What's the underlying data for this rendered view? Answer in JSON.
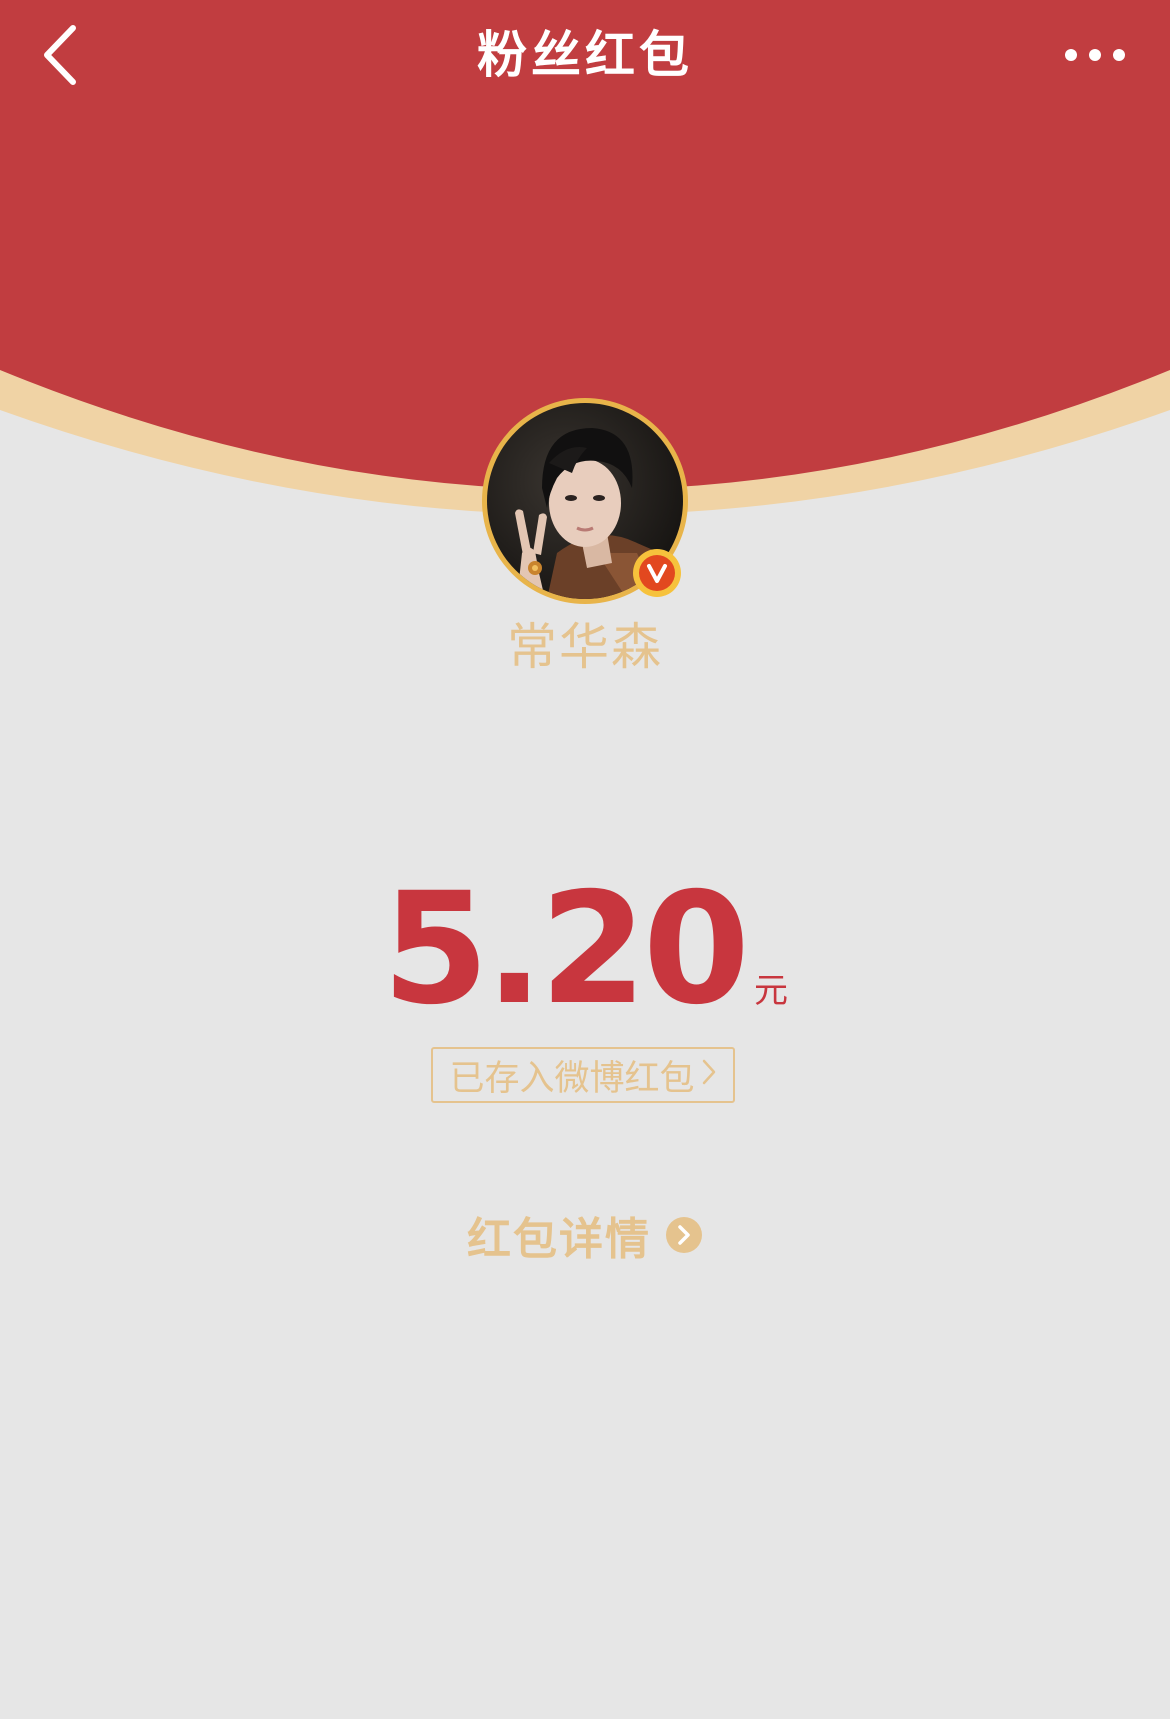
{
  "nav": {
    "title": "粉丝红包",
    "back_icon": "chevron-left-icon",
    "more_icon": "more-dots-icon"
  },
  "sender": {
    "name": "常华森",
    "verified_badge": "V"
  },
  "red_packet": {
    "amount": "5.20",
    "unit": "元",
    "saved_label": "已存入微博红包",
    "details_label": "红包详情"
  },
  "colors": {
    "header_red": "#c13d40",
    "gold": "#e5c38e",
    "amount_red": "#c8363e",
    "background": "#e6e6e6"
  }
}
